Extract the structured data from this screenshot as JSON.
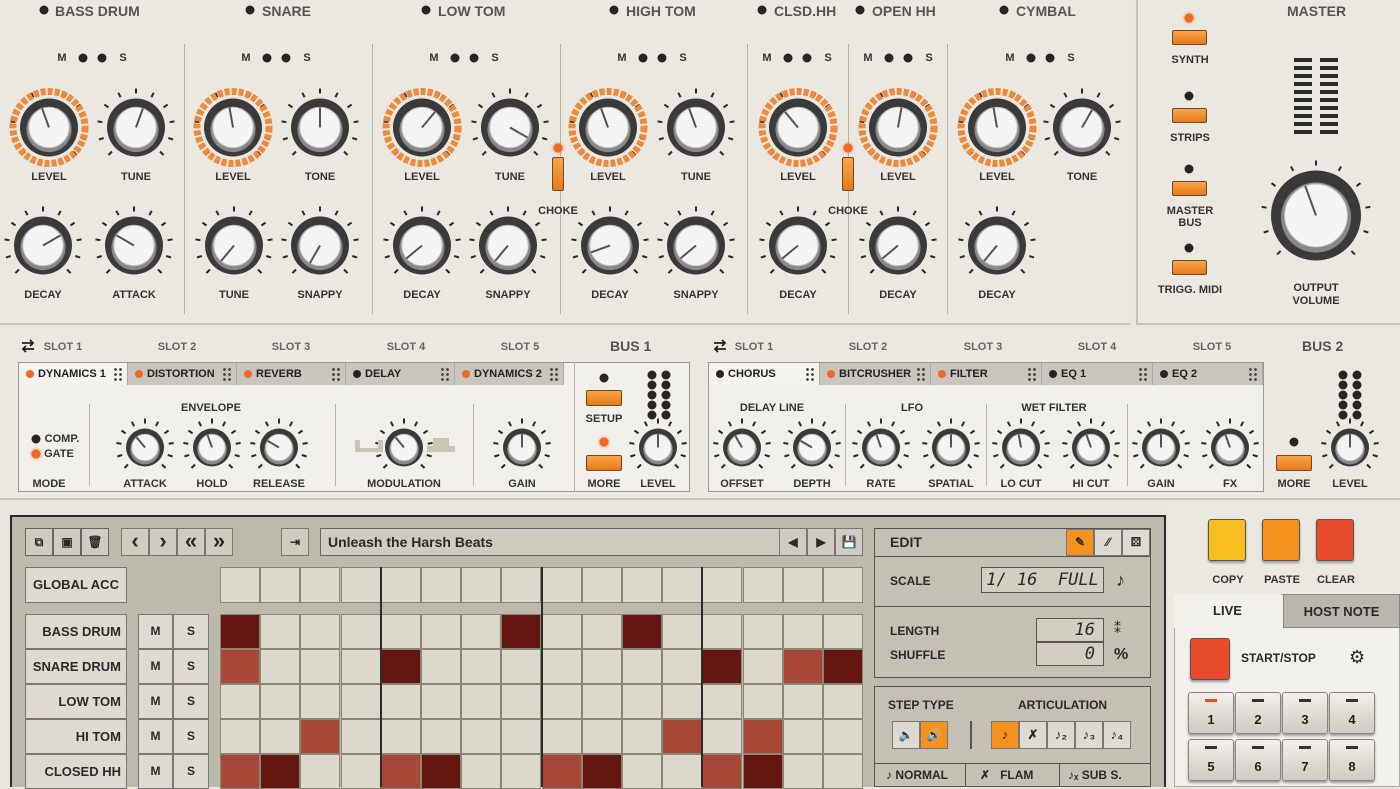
{
  "instruments": [
    {
      "name": "BASS DRUM",
      "top": [
        "LEVEL",
        "TUNE"
      ],
      "bottom": [
        "DECAY",
        "ATTACK"
      ]
    },
    {
      "name": "SNARE",
      "top": [
        "LEVEL",
        "TONE"
      ],
      "bottom": [
        "TUNE",
        "SNAPPY"
      ]
    },
    {
      "name": "LOW TOM",
      "top": [
        "LEVEL",
        "TUNE"
      ],
      "bottom": [
        "DECAY",
        "SNAPPY"
      ]
    },
    {
      "name": "HIGH TOM",
      "top": [
        "LEVEL",
        "TUNE"
      ],
      "bottom": [
        "DECAY",
        "SNAPPY"
      ]
    },
    {
      "name": "CLSD.HH",
      "top": [
        "LEVEL"
      ],
      "bottom": [
        "DECAY"
      ]
    },
    {
      "name": "OPEN HH",
      "top": [
        "LEVEL"
      ],
      "bottom": [
        "DECAY"
      ]
    },
    {
      "name": "CYMBAL",
      "top": [
        "LEVEL",
        "TONE"
      ],
      "bottom": [
        "DECAY"
      ]
    }
  ],
  "ms": {
    "m": "M",
    "s": "S"
  },
  "choke": "CHOKE",
  "master": {
    "title": "MASTER",
    "buttons": [
      "SYNTH",
      "STRIPS",
      "MASTER BUS",
      "TRIGG. MIDI"
    ],
    "output_line1": "OUTPUT",
    "output_line2": "VOLUME"
  },
  "bus1": {
    "slots": [
      "SLOT 1",
      "SLOT 2",
      "SLOT 3",
      "SLOT 4",
      "SLOT 5"
    ],
    "title": "BUS 1",
    "tabs": [
      "DYNAMICS 1",
      "DISTORTION",
      "REVERB",
      "DELAY",
      "DYNAMICS 2"
    ],
    "envelope": "ENVELOPE",
    "comp": "COMP.",
    "gate": "GATE",
    "mode": "MODE",
    "knobs": [
      "ATTACK",
      "HOLD",
      "RELEASE",
      "MODULATION",
      "GAIN"
    ],
    "setup": "SETUP",
    "more": "MORE",
    "level": "LEVEL"
  },
  "bus2": {
    "slots": [
      "SLOT 1",
      "SLOT 2",
      "SLOT 3",
      "SLOT 4",
      "SLOT 5"
    ],
    "title": "BUS 2",
    "tabs": [
      "CHORUS",
      "BITCRUSHER",
      "FILTER",
      "EQ 1",
      "EQ 2"
    ],
    "groups": [
      "DELAY LINE",
      "LFO",
      "WET FILTER"
    ],
    "knobs": [
      "OFFSET",
      "DEPTH",
      "RATE",
      "SPATIAL",
      "LO CUT",
      "HI CUT",
      "GAIN",
      "FX"
    ],
    "more": "MORE",
    "level": "LEVEL"
  },
  "sequencer": {
    "pattern_name": "Unleash the Harsh Beats",
    "global_acc": "GLOBAL ACC",
    "rows": [
      {
        "name": "BASS DRUM",
        "steps": [
          2,
          0,
          0,
          0,
          0,
          0,
          0,
          2,
          0,
          0,
          2,
          0,
          0,
          0,
          0,
          0
        ]
      },
      {
        "name": "SNARE DRUM",
        "steps": [
          1,
          0,
          0,
          0,
          2,
          0,
          0,
          0,
          0,
          0,
          0,
          0,
          2,
          0,
          1,
          2
        ]
      },
      {
        "name": "LOW TOM",
        "steps": [
          0,
          0,
          0,
          0,
          0,
          0,
          0,
          0,
          0,
          0,
          0,
          0,
          0,
          0,
          0,
          0
        ]
      },
      {
        "name": "HI TOM",
        "steps": [
          0,
          0,
          1,
          0,
          0,
          0,
          0,
          0,
          0,
          0,
          0,
          1,
          0,
          1,
          0,
          0
        ]
      },
      {
        "name": "CLOSED HH",
        "steps": [
          1,
          2,
          0,
          0,
          1,
          2,
          0,
          0,
          1,
          2,
          0,
          0,
          1,
          2,
          0,
          0
        ]
      }
    ]
  },
  "edit": {
    "title": "EDIT",
    "scale_label": "SCALE",
    "scale_value": "1/ 16  FULL",
    "length_label": "LENGTH",
    "length_value": "16",
    "shuffle_label": "SHUFFLE",
    "shuffle_value": "0",
    "step_type": "STEP TYPE",
    "articulation": "ARTICULATION",
    "normal": "NORMAL",
    "flam": "FLAM",
    "sub": "SUB S."
  },
  "right": {
    "copy": "COPY",
    "paste": "PASTE",
    "clear": "CLEAR",
    "tab_live": "LIVE",
    "tab_host": "HOST NOTE",
    "startstop": "START/STOP",
    "pads": [
      "1",
      "2",
      "3",
      "4",
      "5",
      "6",
      "7",
      "8"
    ]
  },
  "colors": {
    "orange": "#f5931e",
    "accent": "#e84c2c",
    "step_dark": "#661610",
    "step_light": "#a84638"
  }
}
